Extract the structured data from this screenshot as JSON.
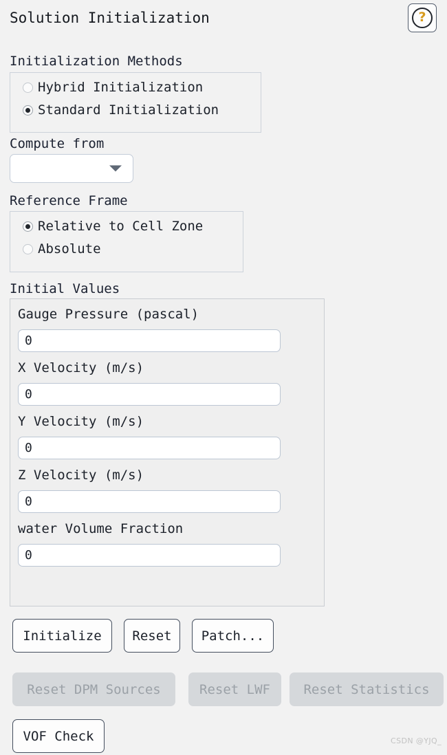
{
  "header": {
    "title": "Solution Initialization",
    "help_icon": "question-mark-icon",
    "help_glyph": "?"
  },
  "initialization_methods": {
    "label": "Initialization Methods",
    "options": [
      {
        "label": "Hybrid  Initialization",
        "selected": false
      },
      {
        "label": "Standard Initialization",
        "selected": true
      }
    ]
  },
  "compute_from": {
    "label": "Compute from",
    "value": "",
    "placeholder": "",
    "arrow_icon": "chevron-down-icon"
  },
  "reference_frame": {
    "label": "Reference Frame",
    "options": [
      {
        "label": "Relative to Cell Zone",
        "selected": true
      },
      {
        "label": "Absolute",
        "selected": false
      }
    ]
  },
  "initial_values": {
    "label": "Initial Values",
    "fields": [
      {
        "label": "Gauge Pressure (pascal)",
        "value": "0"
      },
      {
        "label": "X Velocity (m/s)",
        "value": "0"
      },
      {
        "label": "Y Velocity (m/s)",
        "value": "0"
      },
      {
        "label": "Z Velocity (m/s)",
        "value": "0"
      },
      {
        "label": "water Volume Fraction",
        "value": "0"
      }
    ]
  },
  "actions": {
    "primary": [
      {
        "label": "Initialize",
        "enabled": true
      },
      {
        "label": "Reset",
        "enabled": true
      },
      {
        "label": "Patch...",
        "enabled": true
      }
    ],
    "secondary": [
      {
        "label": "Reset DPM Sources",
        "enabled": false
      },
      {
        "label": "Reset LWF",
        "enabled": false
      },
      {
        "label": "Reset Statistics",
        "enabled": false
      }
    ],
    "tertiary": [
      {
        "label": "VOF Check",
        "enabled": true
      }
    ]
  },
  "watermark": {
    "text": "CSDN @YJQ_"
  },
  "colors": {
    "background": "#f2f2f2",
    "text": "#1b2029",
    "accent": "#d79a1c",
    "button_border": "#434d5d",
    "disabled_bg": "#d5d8db",
    "disabled_text": "#9ba1a7",
    "input_border": "#bcc6d3",
    "group_border": "#ccd2da"
  }
}
